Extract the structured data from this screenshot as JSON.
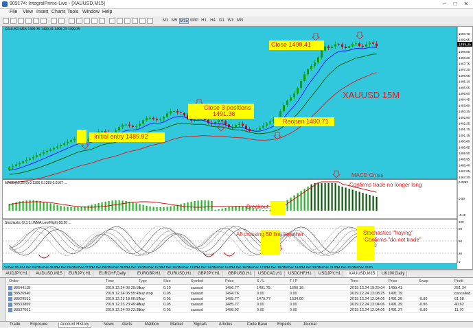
{
  "window": {
    "title": "909174: IntegralPrime-Live - [XAUUSD,M15]",
    "min": "–",
    "max": "□",
    "close": "✕"
  },
  "menu": [
    "File",
    "View",
    "Insert",
    "Charts",
    "Tools",
    "Window",
    "Help"
  ],
  "toolbar": {
    "timeframes": [
      "M1",
      "M5",
      "M15",
      "M30",
      "H1",
      "H4",
      "D1",
      "W1",
      "MN"
    ]
  },
  "chart": {
    "info_line": "XAUUSD,M15  1499.35 1499.41 1499.23 1499.35",
    "symbol_label": "XAUUSD 15M",
    "current_price": "1499.35",
    "price_ticks": [
      "1500.70",
      "1499.95",
      "1499.40",
      "1498.85",
      "1498.30",
      "1497.75",
      "1497.20",
      "1496.65",
      "1496.10",
      "1495.55",
      "1495.00",
      "1494.45",
      "1493.90",
      "1493.35",
      "1492.80",
      "1492.25",
      "1491.70",
      "1491.15",
      "1490.60",
      "1490.05",
      "1489.50",
      "1488.95",
      "1488.40",
      "1487.85",
      "1487.30"
    ],
    "macd_info": "MACD(12,26,9) 0.1390 0.1283 0.0107 ...",
    "macd_ticks": [
      "0.2883",
      "0.00",
      "-0.42"
    ],
    "stoch_info": "Stochastic (9,3,3,LWMA,Low/High) 88.20 ...",
    "stoch_ticks": [
      "100",
      "80",
      "50",
      "20",
      "0"
    ],
    "time_ticks": [
      "24 Dec 2019",
      "24 Dec 04:00",
      "24 Dec 05:00",
      "24 Dec 06:00",
      "24 Dec 07:00",
      "24 Dec 08:00",
      "24 Dec 09:00",
      "24 Dec 10:00",
      "24 Dec 11:00",
      "24 Dec 12:00",
      "24 Dec 13:00",
      "24 Dec 14:00",
      "24 Dec 15:00",
      "24 Dec 16:00",
      "24 Dec 17:00",
      "24 Dec 18:00",
      "24 Dec 19:00",
      "24 Dec 20:00",
      "24 Dec 21:00",
      "24 Dec 22:00",
      "24 Dec 23:00"
    ],
    "colors": {
      "bg": "#31c8de",
      "bull": "#0fa000",
      "bear": "#cc0000",
      "ema_fast": "#1a1aff",
      "ema_mid": "#006400",
      "ema_slow": "#e02020",
      "annotation": "#e02020",
      "highlight": "#ffff00"
    }
  },
  "annotations": {
    "initial_entry": "Initial entry 1489.92",
    "close_3_positions": "Close 3 positions",
    "close_3_price": "1491.36",
    "reopen": "Reopen 1490.71",
    "close_final": "Close 1499.41",
    "macd_cross": "MACD Cross",
    "confirms_trade": "Confirms trade no longer long",
    "breakout": "Breakout",
    "all_crossing": "All crossing 50 line together",
    "stoch_fraying": "Stochastics \"fraying\"",
    "confirms_do_not": "Confirms \"do not trade\""
  },
  "chart_tabs": [
    "AUDJPY,H1",
    "AUDUSD,M15",
    "EURJPY,H1",
    "EURCHF,Daily",
    "EURGBP,H1",
    "EURUSD,H1",
    "GBPJPY,H1",
    "GBPUSD,H1",
    "USDCAD,H1",
    "USDCHF,H1",
    "USDJPY,H1",
    "XAUUSD,M15",
    "UK100,Daily"
  ],
  "active_chart_tab": "XAUUSD,M15",
  "terminal": {
    "headers": [
      "Order",
      "Time",
      "Type",
      "Size",
      "Symbol",
      "Price",
      "S / L",
      "T / P",
      "Time",
      "Price",
      "Swap",
      "Profit"
    ],
    "rows": [
      [
        "38544119",
        "2019.12.24 05:29:19",
        "buy",
        "0.10",
        "xauusd",
        "1486.77",
        "1491.75",
        "1500.16",
        "2019.12.24 18:29:04",
        "1499.41",
        "",
        "251.34"
      ],
      [
        "38526940",
        "2019.12.24 05:55:41",
        "buy stop",
        "0.05",
        "xauusd",
        "1494.76",
        "0.00",
        "0.00",
        "2019.12.24 12:08:25",
        "1491.79",
        "",
        "cancelled"
      ],
      [
        "38529551",
        "2019.12.23 18:06:57",
        "buy",
        "0.05",
        "xauusd",
        "1485.77",
        "1479.77",
        "1534.00",
        "2019.12.24 12:04:06",
        "1491.36",
        "-0.96",
        "61.58"
      ],
      [
        "38533869",
        "2019.12.23 23:49:46",
        "buy",
        "0.05",
        "xauusd",
        "1485.77",
        "0.00",
        "0.00",
        "2019.12.24 12:04:06",
        "1491.39",
        "-0.96",
        "40.62"
      ],
      [
        "38537061",
        "2019.12.24 00:23:35",
        "buy",
        "0.05",
        "xauusd",
        "1488.92",
        "0.00",
        "0.00",
        "2019.12.24 12:04:06",
        "1491.37",
        "-0.96",
        "11.70"
      ]
    ]
  },
  "terminal_tabs": [
    "Trade",
    "Exposure",
    "Account History",
    "News",
    "Alerts",
    "Mailbox",
    "Market",
    "Signals",
    "Articles",
    "Code Base",
    "Experts",
    "Journal"
  ],
  "active_terminal_tab": "Account History"
}
